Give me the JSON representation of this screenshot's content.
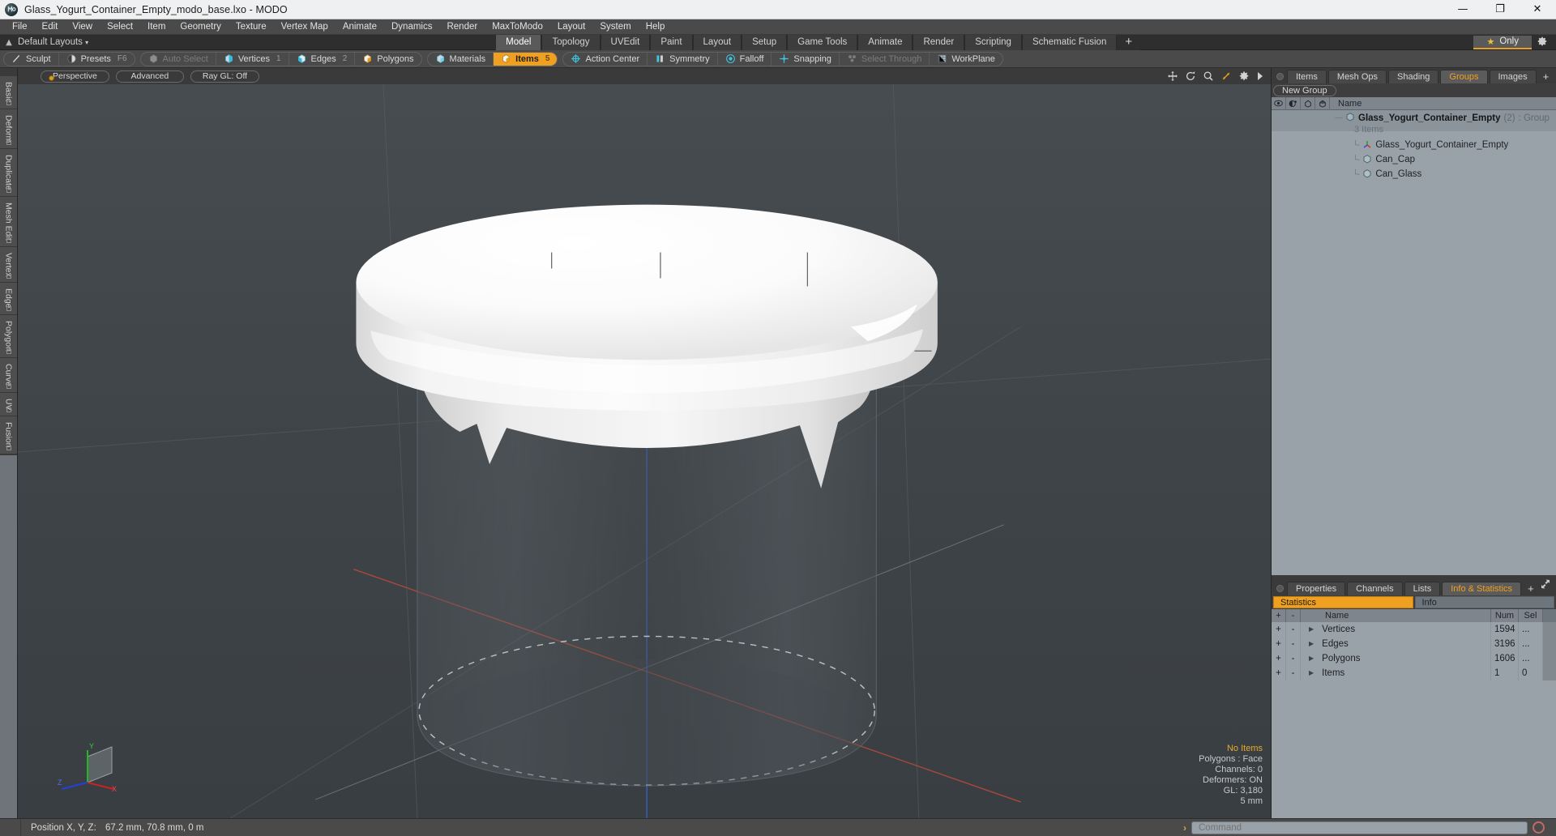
{
  "window": {
    "title": "Glass_Yogurt_Container_Empty_modo_base.lxo - MODO",
    "app_icon": "modo-logo-icon",
    "minimize": "—",
    "maximize": "❐",
    "close": "✕"
  },
  "menubar": {
    "items": [
      "File",
      "Edit",
      "View",
      "Select",
      "Item",
      "Geometry",
      "Texture",
      "Vertex Map",
      "Animate",
      "Dynamics",
      "Render",
      "MaxToModo",
      "Layout",
      "System",
      "Help"
    ]
  },
  "layoutbar": {
    "preset_label": "Default Layouts",
    "caret": "▾",
    "tabs": [
      {
        "label": "Model",
        "active": true
      },
      {
        "label": "Topology",
        "active": false
      },
      {
        "label": "UVEdit",
        "active": false
      },
      {
        "label": "Paint",
        "active": false
      },
      {
        "label": "Layout",
        "active": false
      },
      {
        "label": "Setup",
        "active": false
      },
      {
        "label": "Game Tools",
        "active": false
      },
      {
        "label": "Animate",
        "active": false
      },
      {
        "label": "Render",
        "active": false
      },
      {
        "label": "Scripting",
        "active": false
      },
      {
        "label": "Schematic Fusion",
        "active": false
      }
    ],
    "add_tab": "+",
    "only_label": "Only",
    "star": "★",
    "gear": "gear-icon"
  },
  "toolrow": {
    "group1": [
      {
        "label": "Sculpt",
        "icon": "sculpt-icon",
        "state": "normal",
        "num": ""
      },
      {
        "label": "Presets",
        "icon": "presets-icon",
        "state": "normal",
        "num": "F6"
      }
    ],
    "group2": [
      {
        "label": "Auto Select",
        "icon": "cube-grey-icon",
        "state": "disabled",
        "num": ""
      },
      {
        "label": "Vertices",
        "icon": "cube-vertices-icon",
        "state": "normal",
        "num": "1"
      },
      {
        "label": "Edges",
        "icon": "cube-edges-icon",
        "state": "normal",
        "num": "2"
      },
      {
        "label": "Polygons",
        "icon": "cube-polygons-icon",
        "state": "normal",
        "num": ""
      }
    ],
    "group3": [
      {
        "label": "Materials",
        "icon": "cube-materials-icon",
        "state": "normal",
        "num": ""
      },
      {
        "label": "Items",
        "icon": "cube-items-icon",
        "state": "active",
        "num": "5"
      }
    ],
    "group4": [
      {
        "label": "Action Center",
        "icon": "action-center-icon",
        "state": "normal",
        "num": ""
      },
      {
        "label": "Symmetry",
        "icon": "symmetry-icon",
        "state": "normal",
        "num": ""
      },
      {
        "label": "Falloff",
        "icon": "falloff-icon",
        "state": "normal",
        "num": ""
      },
      {
        "label": "Snapping",
        "icon": "snapping-icon",
        "state": "normal",
        "num": ""
      },
      {
        "label": "Select Through",
        "icon": "select-through-icon",
        "state": "disabled",
        "num": ""
      },
      {
        "label": "WorkPlane",
        "icon": "workplane-icon",
        "state": "normal",
        "num": ""
      }
    ]
  },
  "vtabs": {
    "items": [
      "Basic",
      "Deform",
      "Duplicate",
      "Mesh Edit",
      "Vertex",
      "Edge",
      "Polygon",
      "Curve",
      "UV",
      "Fusion"
    ]
  },
  "viewport": {
    "view_mode": "Perspective",
    "shading": "Advanced",
    "raygl": "Ray GL: Off",
    "icons": [
      "move-icon",
      "rotate-icon",
      "zoom-icon",
      "fit-icon",
      "gear-icon",
      "play-arrow-icon"
    ],
    "overlay": {
      "selection": "No Items",
      "mode": "Polygons : Face",
      "channels": "Channels: 0",
      "deformers": "Deformers: ON",
      "gl": "GL: 3,180",
      "scale": "5 mm"
    },
    "gizmo": {
      "x": "X",
      "y": "Y",
      "z": "Z"
    }
  },
  "right_panel": {
    "tabs": [
      {
        "label": "Items",
        "active": false
      },
      {
        "label": "Mesh Ops",
        "active": false
      },
      {
        "label": "Shading",
        "active": false
      },
      {
        "label": "Groups",
        "active": true
      },
      {
        "label": "Images",
        "active": false
      }
    ],
    "add_tab": "+",
    "new_group_label": "New Group",
    "columns": {
      "eye": "visibility-icon",
      "render": "render-icon",
      "lock": "lock-icon",
      "wire": "wireframe-icon",
      "name": "Name"
    },
    "group": {
      "name": "Glass_Yogurt_Container_Empty",
      "count": "(2)",
      "type": ": Group",
      "items_label": "3 Items",
      "children": [
        {
          "label": "Glass_Yogurt_Container_Empty",
          "icon": "locator-axis-icon"
        },
        {
          "label": "Can_Cap",
          "icon": "mesh-cube-icon"
        },
        {
          "label": "Can_Glass",
          "icon": "mesh-cube-icon"
        }
      ]
    }
  },
  "stats_panel": {
    "tabs": [
      {
        "label": "Properties",
        "active": false
      },
      {
        "label": "Channels",
        "active": false
      },
      {
        "label": "Lists",
        "active": false
      },
      {
        "label": "Info & Statistics",
        "active": true
      }
    ],
    "add_tab": "+",
    "segments": [
      {
        "label": "Statistics",
        "active": true
      },
      {
        "label": "Info",
        "active": false
      }
    ],
    "columns": [
      "+",
      "-",
      "Name",
      "Num",
      "Sel"
    ],
    "rows": [
      {
        "plus": "+",
        "minus": "-",
        "name": "Vertices",
        "num": "1594",
        "sel": "..."
      },
      {
        "plus": "+",
        "minus": "-",
        "name": "Edges",
        "num": "3196",
        "sel": "..."
      },
      {
        "plus": "+",
        "minus": "-",
        "name": "Polygons",
        "num": "1606",
        "sel": "..."
      },
      {
        "plus": "+",
        "minus": "-",
        "name": "Items",
        "num": "1",
        "sel": "0"
      }
    ]
  },
  "bottombar": {
    "position_label": "Position X, Y, Z:",
    "position_value": "67.2 mm, 70.8 mm, 0 m",
    "command_placeholder": "Command",
    "chevron": "›",
    "record": "record-button"
  },
  "colors": {
    "accent_orange": "#f0a020",
    "panel_grey": "#9aa2a9",
    "chrome_dark": "#3a3a3a",
    "viewport_bg": "#3f4448",
    "axis_x": "#c0392b",
    "axis_y": "#2f6fd0",
    "axis_z": "#2f6fd0"
  }
}
